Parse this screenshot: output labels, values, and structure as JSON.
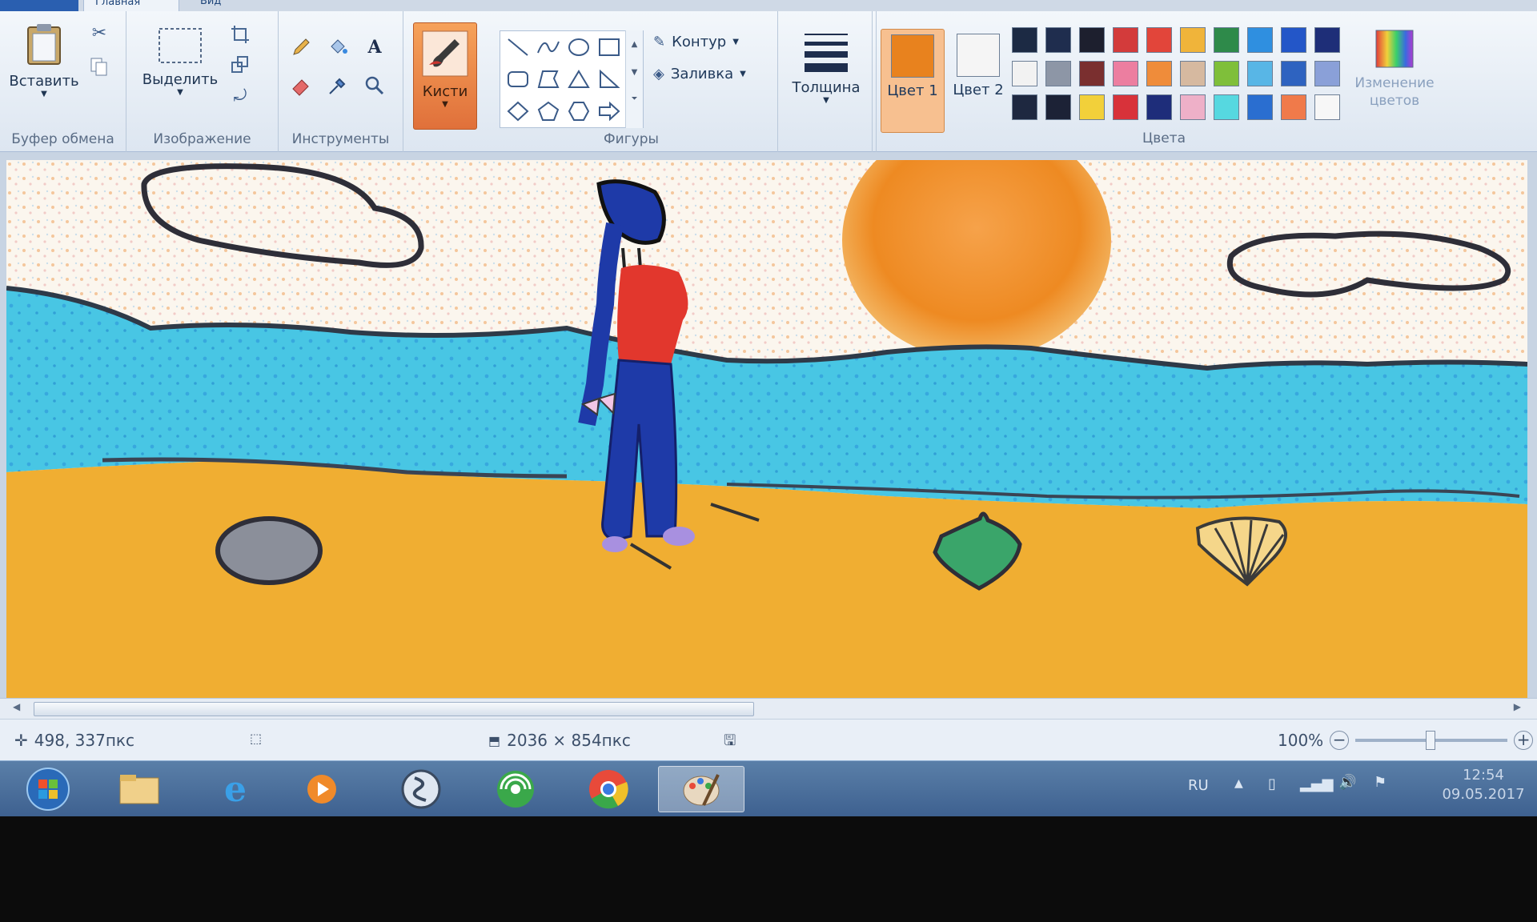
{
  "tabs": {
    "file": "",
    "home": "Главная",
    "view": "Вид"
  },
  "clipboard": {
    "paste_label": "Вставить",
    "group_label": "Буфер обмена"
  },
  "image": {
    "select_label": "Выделить",
    "group_label": "Изображение"
  },
  "tools": {
    "group_label": "Инструменты"
  },
  "brushes": {
    "label": "Кисти"
  },
  "shapes": {
    "group_label": "Фигуры",
    "outline_label": "Контур",
    "fill_label": "Заливка"
  },
  "size": {
    "label": "Толщина"
  },
  "colors": {
    "group_label": "Цвета",
    "color1_label": "Цвет 1",
    "color2_label": "Цвет 2",
    "edit_label": "Изменение цветов",
    "color1": "#e8821e",
    "color2": "#f5f5f5",
    "palette": [
      [
        "#1c2a44",
        "#1f2d4e",
        "#1d1f2e",
        "#d33b3b",
        "#e2453a",
        "#f0b43a",
        "#2e8a4a",
        "#2f8fe0",
        "#2356c8",
        "#1e2e78"
      ],
      [
        "#f2f2f2",
        "#8d96a6",
        "#7a2f2f",
        "#ec7ea0",
        "#ef8c3a",
        "#d6b9a0",
        "#7fbf3a",
        "#58b6e6",
        "#2e63c0",
        "#8aa0d8"
      ],
      [
        "#1e2840",
        "#1c2236",
        "#f2d03a",
        "#d8323a",
        "#1e2d7a",
        "#eeb0c8",
        "#56d8e0",
        "#2a6ed0",
        "#f07a4a",
        "#f7f7f7"
      ]
    ]
  },
  "status": {
    "cursor": "498, 337пкс",
    "dimensions": "2036 × 854пкс",
    "zoom": "100%"
  },
  "tray": {
    "lang": "RU",
    "time": "12:54",
    "date": "09.05.2017"
  },
  "taskbar": {
    "icons": [
      "start-orb-icon",
      "explorer-icon",
      "internet-explorer-icon",
      "media-player-icon",
      "steam-like-icon",
      "network-app-icon",
      "chrome-icon",
      "paint-icon"
    ]
  }
}
